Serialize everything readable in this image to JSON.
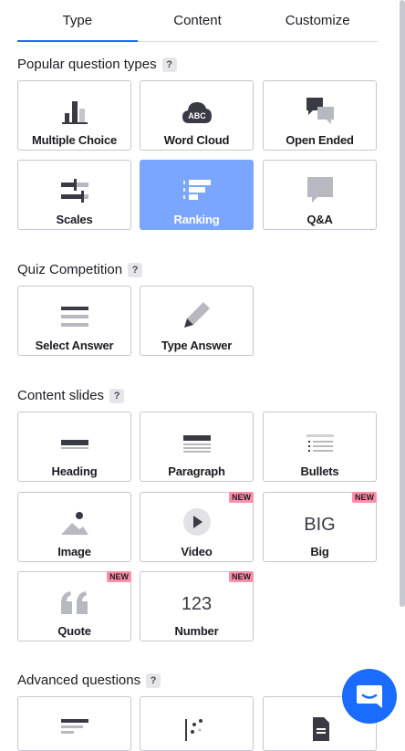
{
  "tabs": [
    "Type",
    "Content",
    "Customize"
  ],
  "sections": {
    "popular": {
      "title": "Popular question types",
      "help": "?"
    },
    "quiz": {
      "title": "Quiz Competition",
      "help": "?"
    },
    "content": {
      "title": "Content slides",
      "help": "?"
    },
    "advanced": {
      "title": "Advanced questions",
      "help": "?"
    }
  },
  "popular_cards": [
    {
      "label": "Multiple Choice",
      "icon": "bar-chart-icon"
    },
    {
      "label": "Word Cloud",
      "icon": "word-cloud-icon",
      "icon_text": "ABC"
    },
    {
      "label": "Open Ended",
      "icon": "speech-bubbles-icon"
    },
    {
      "label": "Scales",
      "icon": "sliders-icon"
    },
    {
      "label": "Ranking",
      "icon": "ranking-icon",
      "selected": true
    },
    {
      "label": "Q&A",
      "icon": "chat-bubble-icon"
    }
  ],
  "quiz_cards": [
    {
      "label": "Select Answer",
      "icon": "list-lines-icon"
    },
    {
      "label": "Type Answer",
      "icon": "pencil-icon"
    }
  ],
  "content_cards": [
    {
      "label": "Heading",
      "icon": "heading-icon"
    },
    {
      "label": "Paragraph",
      "icon": "paragraph-icon"
    },
    {
      "label": "Bullets",
      "icon": "bullets-icon"
    },
    {
      "label": "Image",
      "icon": "image-icon"
    },
    {
      "label": "Video",
      "icon": "play-icon",
      "badge": "NEW"
    },
    {
      "label": "Big",
      "icon": "big-text-icon",
      "icon_text": "BIG",
      "badge": "NEW"
    },
    {
      "label": "Quote",
      "icon": "quote-icon",
      "badge": "NEW"
    },
    {
      "label": "Number",
      "icon": "number-icon",
      "icon_text": "123",
      "badge": "NEW"
    }
  ],
  "colors": {
    "accent": "#196cff",
    "selected": "#7ba6ff",
    "badge": "#ff8fa8"
  }
}
